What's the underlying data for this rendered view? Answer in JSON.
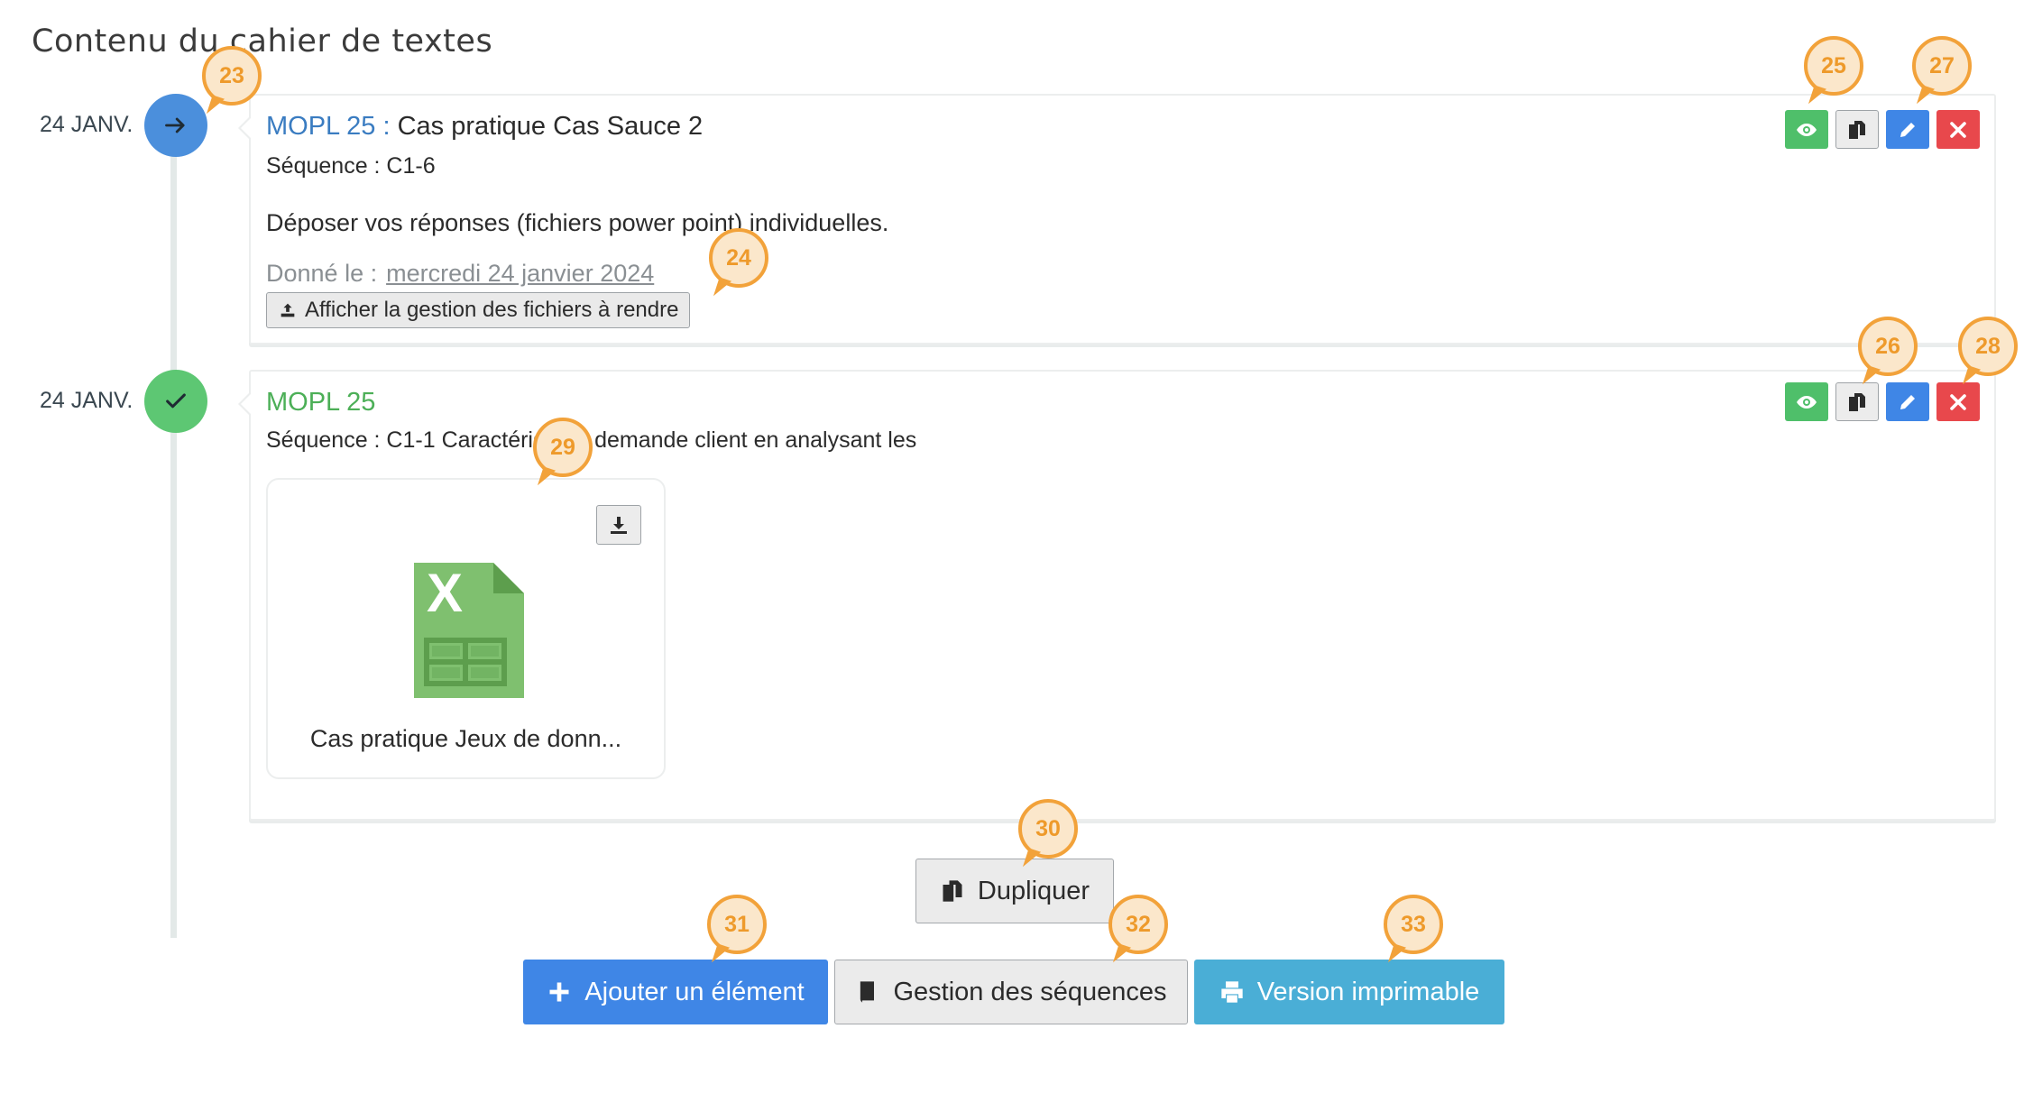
{
  "page": {
    "title": "Contenu du cahier de textes"
  },
  "entries": [
    {
      "date": "24 JANV.",
      "status": "in-progress",
      "course": "MOPL 25 :",
      "title": "Cas pratique Cas Sauce 2",
      "sequence": "Séquence : C1-6",
      "description": "Déposer vos réponses (fichiers power point) individuelles.",
      "given_label": "Donné le :",
      "given_date": "mercredi 24 janvier 2024",
      "files_button": "Afficher la gestion des fichiers à rendre"
    },
    {
      "date": "24 JANV.",
      "status": "done",
      "course": "MOPL 25",
      "sequence": "Séquence : C1-1 Caractériser la demande client en analysant les",
      "attachment": {
        "name": "Cas pratique Jeux de donn...",
        "type": "xlsx"
      }
    }
  ],
  "buttons": {
    "duplicate": "Dupliquer",
    "add": "Ajouter un élément",
    "sequences": "Gestion des séquences",
    "print": "Version imprimable"
  },
  "callouts": {
    "c23": "23",
    "c24": "24",
    "c25": "25",
    "c26": "26",
    "c27": "27",
    "c28": "28",
    "c29": "29",
    "c30": "30",
    "c31": "31",
    "c32": "32",
    "c33": "33"
  },
  "colors": {
    "callout": "#f2a23a",
    "marker_blue": "#4b8fdc",
    "marker_green": "#5dc773",
    "course_blue": "#3a7cc1",
    "course_green": "#4caf57"
  }
}
